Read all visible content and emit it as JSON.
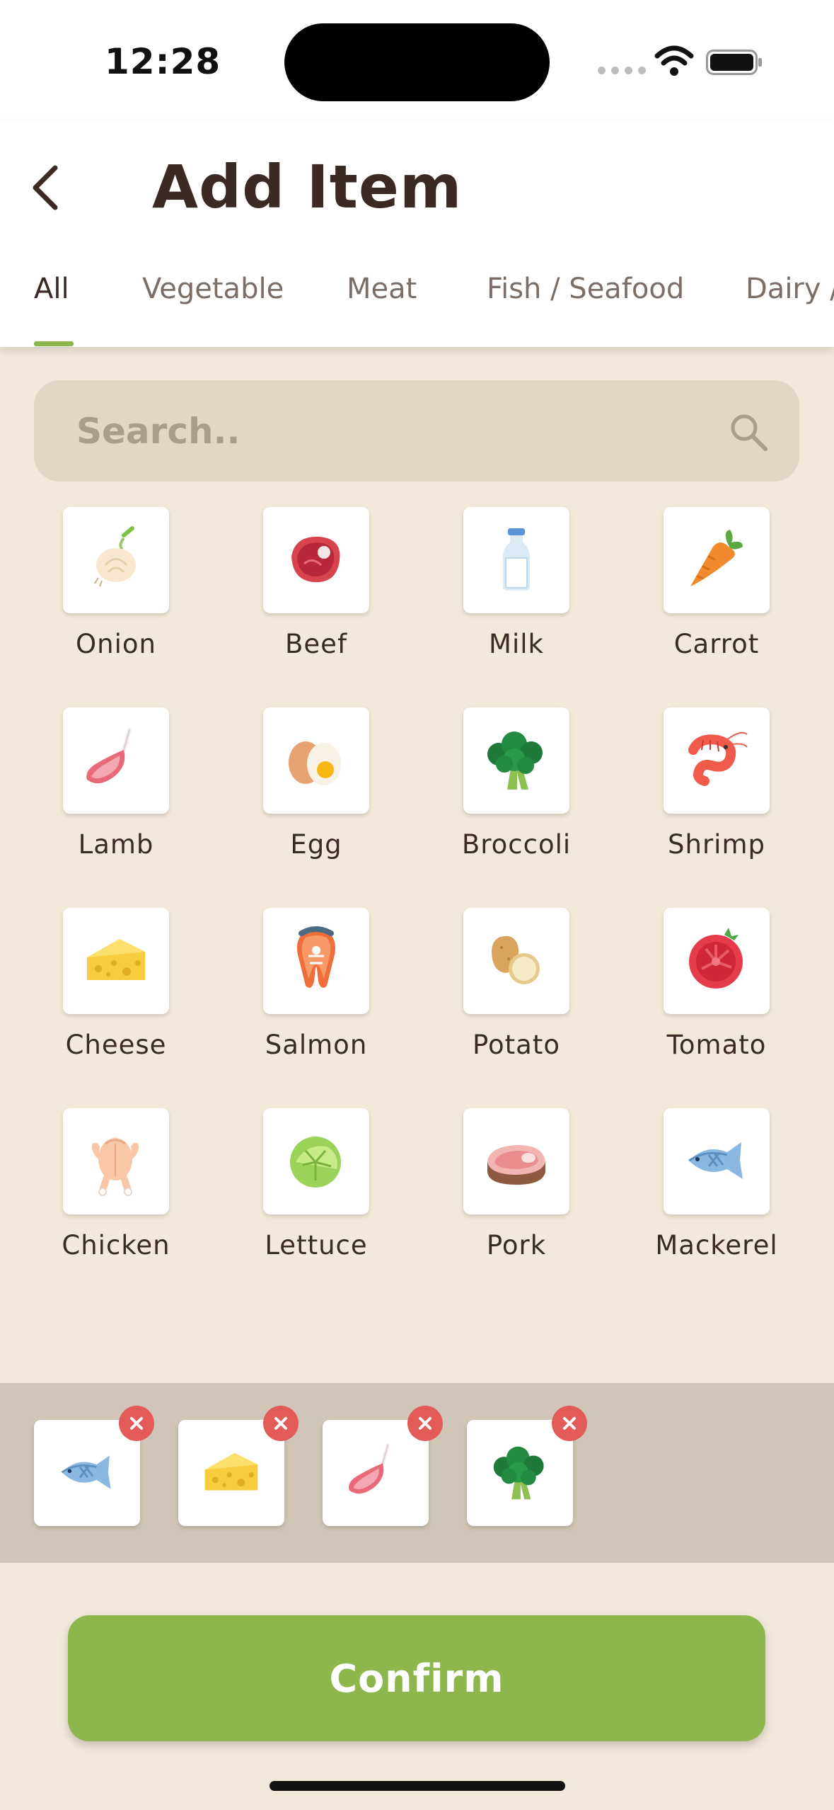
{
  "status": {
    "time": "12:28"
  },
  "header": {
    "title": "Add Item",
    "tabs": [
      {
        "label": "All",
        "active": true
      },
      {
        "label": "Vegetable"
      },
      {
        "label": "Meat"
      },
      {
        "label": "Fish / Seafood"
      },
      {
        "label": "Dairy /"
      }
    ]
  },
  "search": {
    "placeholder": "Search.."
  },
  "items": [
    {
      "label": "Onion",
      "icon": "onion-icon"
    },
    {
      "label": "Beef",
      "icon": "beef-icon"
    },
    {
      "label": "Milk",
      "icon": "milk-icon"
    },
    {
      "label": "Carrot",
      "icon": "carrot-icon"
    },
    {
      "label": "Lamb",
      "icon": "lamb-icon"
    },
    {
      "label": "Egg",
      "icon": "egg-icon"
    },
    {
      "label": "Broccoli",
      "icon": "broccoli-icon"
    },
    {
      "label": "Shrimp",
      "icon": "shrimp-icon"
    },
    {
      "label": "Cheese",
      "icon": "cheese-icon"
    },
    {
      "label": "Salmon",
      "icon": "salmon-icon"
    },
    {
      "label": "Potato",
      "icon": "potato-icon"
    },
    {
      "label": "Tomato",
      "icon": "tomato-icon"
    },
    {
      "label": "Chicken",
      "icon": "chicken-icon"
    },
    {
      "label": "Lettuce",
      "icon": "lettuce-icon"
    },
    {
      "label": "Pork",
      "icon": "pork-icon"
    },
    {
      "label": "Mackerel",
      "icon": "mackerel-icon"
    }
  ],
  "selected": [
    {
      "icon": "mackerel-icon"
    },
    {
      "icon": "cheese-icon"
    },
    {
      "icon": "lamb-icon"
    },
    {
      "icon": "broccoli-icon"
    }
  ],
  "confirm_label": "Confirm",
  "colors": {
    "accent": "#8DB64D",
    "background": "#F3E9DA",
    "remove": "#E25B58",
    "text": "#3B2A24"
  }
}
